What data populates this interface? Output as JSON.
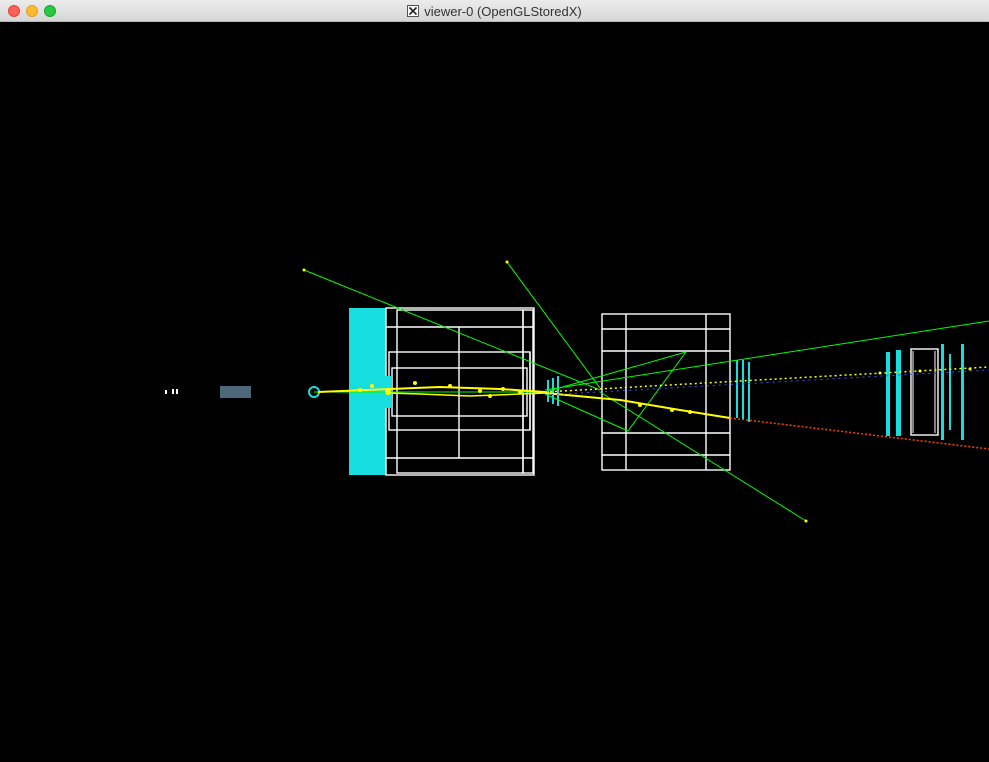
{
  "window": {
    "title": "viewer-0 (OpenGLStoredX)",
    "title_icon": "x11-icon",
    "controls": [
      "close-button",
      "minimize-button",
      "zoom-button"
    ]
  },
  "scene": {
    "background": "#000000",
    "colors": {
      "detector_wire": "#ffffff",
      "detector_solid": "#17dede",
      "steel_block": "#4d6878",
      "charged_track": "#ffff00",
      "neutral_track": "#00ff00",
      "hit_blue": "#0000ff",
      "hit_red": "#ff0000"
    }
  }
}
